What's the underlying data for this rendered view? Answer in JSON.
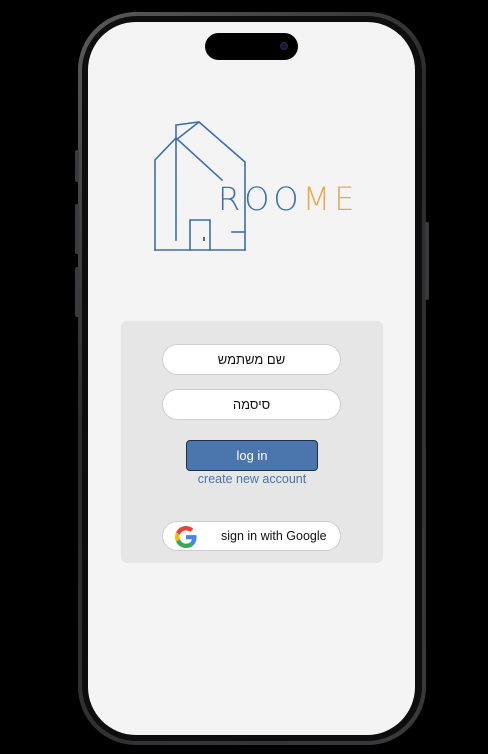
{
  "logo": {
    "text_part1": "ROO",
    "text_part2": "ME",
    "color_primary": "#3f6fa8",
    "color_accent": "#e7a955"
  },
  "login_form": {
    "username_placeholder": "שם משתמש",
    "password_placeholder": "סיסמה",
    "login_label": "log in",
    "create_account_label": "create new account",
    "google_label": "sign in with Google",
    "google_icon": "google-logo-icon"
  },
  "colors": {
    "button_primary": "#4a76ad",
    "screen_background": "#f4f4f4",
    "card_background": "#e6e6e6"
  }
}
